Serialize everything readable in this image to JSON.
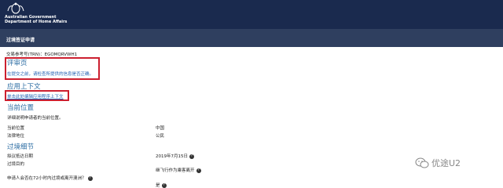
{
  "header": {
    "gov_line1": "Australian Government",
    "gov_line2": "Department of Home Affairs"
  },
  "app": {
    "title": "过境签证申请"
  },
  "trn": {
    "label": "交易参考号(TRN)：",
    "value": "EGOMQRVWH1"
  },
  "review": {
    "heading": "评审页",
    "note": "在提交之前，请检查所提供的信息是否正确。"
  },
  "context": {
    "heading": "应用上下文",
    "link": "单击此处编辑应用程序上下文"
  },
  "location": {
    "heading": "当前位置",
    "desc": "详细说明申请者的当前位置。",
    "rows": [
      {
        "label": "当前位置",
        "value": "中国"
      },
      {
        "label": "法律地位",
        "value": "公民"
      }
    ]
  },
  "transit": {
    "heading": "过境细节",
    "arrival_label": "拟议抵达日期",
    "arrival_value": "2019年7月15日",
    "purpose_label": "过境目的",
    "purpose_value": "继飞行作为乘客离开",
    "question": "申请人会否在72小时内过境或离开澳洲？",
    "answer": "是"
  },
  "watermark": {
    "text": "优途U2"
  }
}
